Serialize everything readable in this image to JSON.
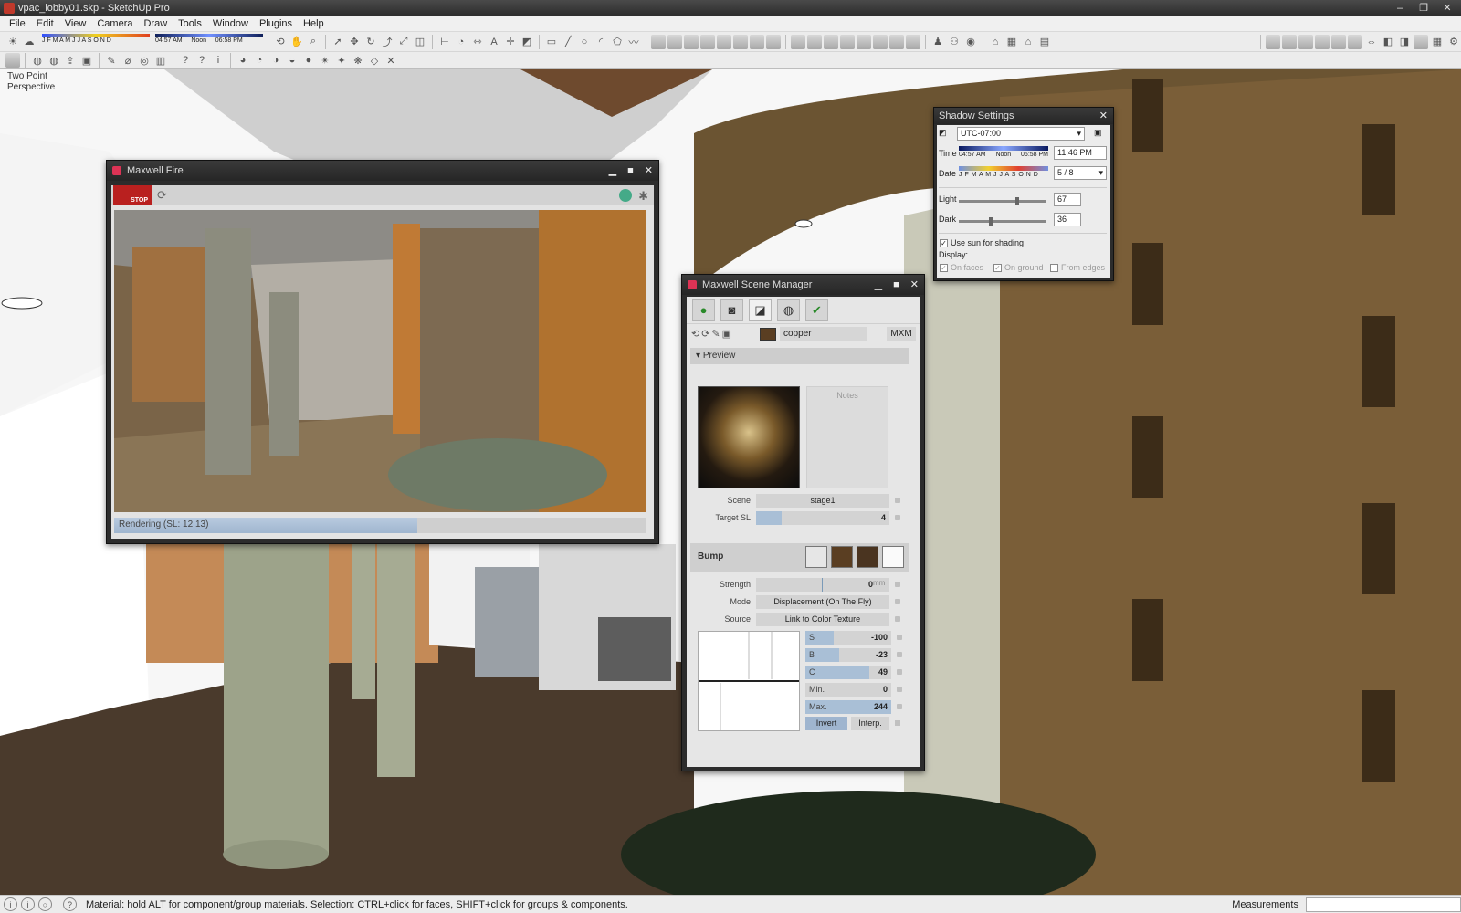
{
  "window": {
    "title": "vpac_lobby01.skp - SketchUp Pro",
    "controls": [
      "‒",
      "❐",
      "✕"
    ]
  },
  "menu": [
    "File",
    "Edit",
    "View",
    "Camera",
    "Draw",
    "Tools",
    "Window",
    "Plugins",
    "Help"
  ],
  "toolbar_shadow": {
    "months": "J F M A M J J A S O N D",
    "time_start": "04:57 AM",
    "time_noon": "Noon",
    "time_end": "06:58 PM"
  },
  "scene_label": {
    "line1": "Two Point",
    "line2": "Perspective"
  },
  "maxwell_fire": {
    "title": "Maxwell Fire",
    "stop_label": "STOP",
    "progress_label": "Rendering (SL: 12.13)",
    "progress_fraction": 0.57
  },
  "shadow_settings": {
    "title": "Shadow Settings",
    "timezone": "UTC-07:00",
    "time_label": "Time",
    "time_start": "04:57 AM",
    "time_noon": "Noon",
    "time_end": "06:58 PM",
    "time_value": "11:46 PM",
    "date_label": "Date",
    "months": "J F M A M J J A S O N D",
    "date_value": "5 / 8",
    "light_label": "Light",
    "light_value": "67",
    "light_fraction": 0.67,
    "dark_label": "Dark",
    "dark_value": "36",
    "dark_fraction": 0.36,
    "use_sun": "Use sun for shading",
    "display_label": "Display:",
    "on_faces": "On faces",
    "on_ground": "On ground",
    "from_edges": "From edges"
  },
  "scene_manager": {
    "title": "Maxwell Scene Manager",
    "material_name": "copper",
    "format": "MXM",
    "preview_label": "Preview",
    "notes_label": "Notes",
    "scene_label": "Scene",
    "scene_value": "stage1",
    "target_label": "Target SL",
    "target_value": "4",
    "target_fraction": 0.19,
    "bump_label": "Bump",
    "strength_label": "Strength",
    "strength_value": "0",
    "strength_unit": "mm",
    "mode_label": "Mode",
    "mode_value": "Displacement (On The Fly)",
    "source_label": "Source",
    "source_value": "Link to Color Texture",
    "params": [
      {
        "label": "S",
        "value": "-100",
        "fraction": 0.33
      },
      {
        "label": "B",
        "value": "-23",
        "fraction": 0.39
      },
      {
        "label": "C",
        "value": "49",
        "fraction": 0.74
      },
      {
        "label": "Min.",
        "value": "0",
        "fraction": 0.0
      },
      {
        "label": "Max.",
        "value": "244",
        "fraction": 1.0
      }
    ],
    "invert_label": "Invert",
    "interp_label": "Interp."
  },
  "status": {
    "message": "Material: hold ALT for component/group materials. Selection: CTRL+click for faces, SHIFT+click for groups & components.",
    "measurements_label": "Measurements"
  }
}
